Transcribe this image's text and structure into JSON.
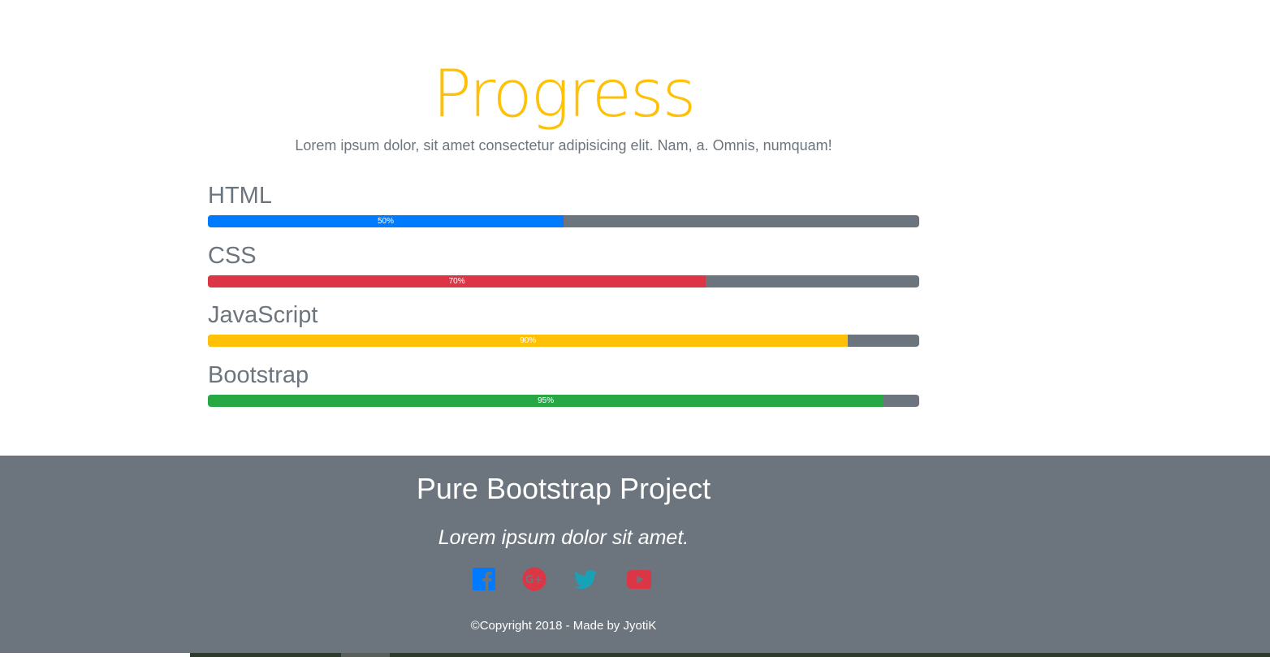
{
  "page": {
    "title": "Progress",
    "subtitle": "Lorem ipsum dolor, sit amet consectetur adipisicing elit. Nam, a. Omnis, numquam!"
  },
  "skills": [
    {
      "name": "HTML",
      "percent": 50,
      "label": "50%",
      "color": "#007bff"
    },
    {
      "name": "CSS",
      "percent": 70,
      "label": "70%",
      "color": "#dc3545"
    },
    {
      "name": "JavaScript",
      "percent": 90,
      "label": "90%",
      "color": "#ffc107"
    },
    {
      "name": "Bootstrap",
      "percent": 95,
      "label": "95%",
      "color": "#28a745"
    }
  ],
  "footer": {
    "title": "Pure Bootstrap Project",
    "tagline": "Lorem ipsum dolor sit amet.",
    "social": [
      {
        "icon": "facebook-icon",
        "color": "#007bff"
      },
      {
        "icon": "google-plus-icon",
        "color": "#dc3545"
      },
      {
        "icon": "twitter-icon",
        "color": "#17a2b8"
      },
      {
        "icon": "youtube-icon",
        "color": "#dc3545"
      }
    ],
    "copyright": "©Copyright 2018 - Made by JyotiK"
  }
}
